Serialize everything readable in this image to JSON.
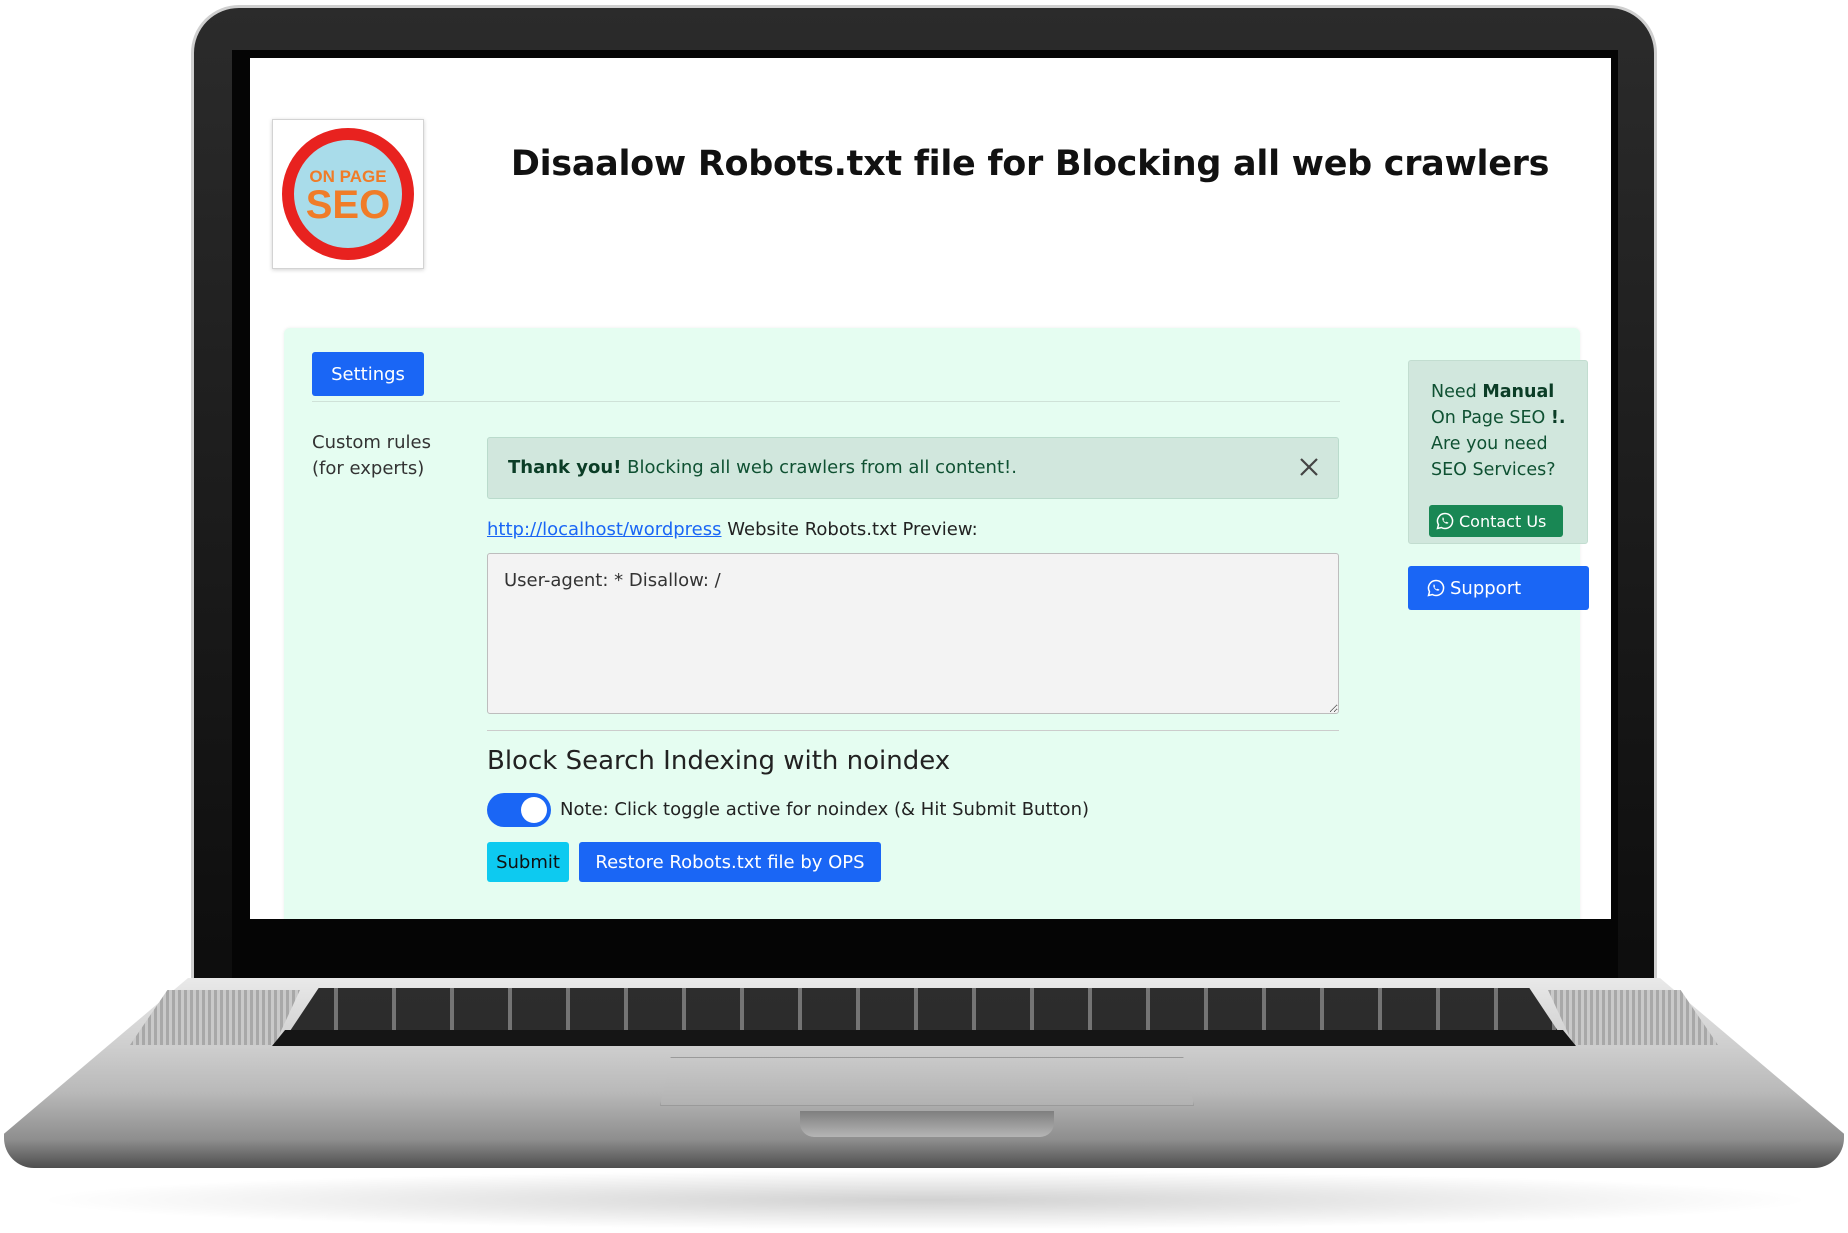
{
  "header": {
    "logo_text_top": "ON PAGE",
    "logo_text_main": "SEO",
    "title": "Disaalow Robots.txt file for Blocking all web crawlers"
  },
  "tabs": [
    {
      "label": "Settings",
      "active": true
    }
  ],
  "form": {
    "side_label_line1": "Custom rules",
    "side_label_line2": "(for experts)",
    "alert": {
      "strong": "Thank you!",
      "message": "Blocking all web crawlers from all content!."
    },
    "preview": {
      "link_text": "http://localhost/wordpress",
      "suffix": "Website Robots.txt Preview:"
    },
    "robots_content": "User-agent: * Disallow: /",
    "noindex": {
      "title": "Block Search Indexing with noindex",
      "note": "Note: Click toggle active for noindex (& Hit Submit Button)",
      "enabled": true
    },
    "submit_label": "Submit",
    "restore_label": "Restore Robots.txt file by OPS"
  },
  "sidebar": {
    "promo_line1_prefix": "Need",
    "promo_line1_bold": "Manual",
    "promo_line2_prefix": "On Page SEO",
    "promo_line2_bold": "!.",
    "promo_line3": "Are you need",
    "promo_line4": "SEO Services?",
    "contact_label": "Contact Us",
    "support_label": "Support"
  },
  "icons": {
    "close": "close-icon",
    "contact": "whatsapp-icon",
    "support": "whatsapp-icon"
  },
  "colors": {
    "primary": "#1a66f5",
    "info": "#0dcaf0",
    "success": "#198754",
    "panel_bg": "#e5fdf1",
    "alert_bg": "#d1e7dd",
    "logo_ring": "#e8221f",
    "logo_fill": "#a9dcea",
    "logo_text": "#f07c28"
  }
}
